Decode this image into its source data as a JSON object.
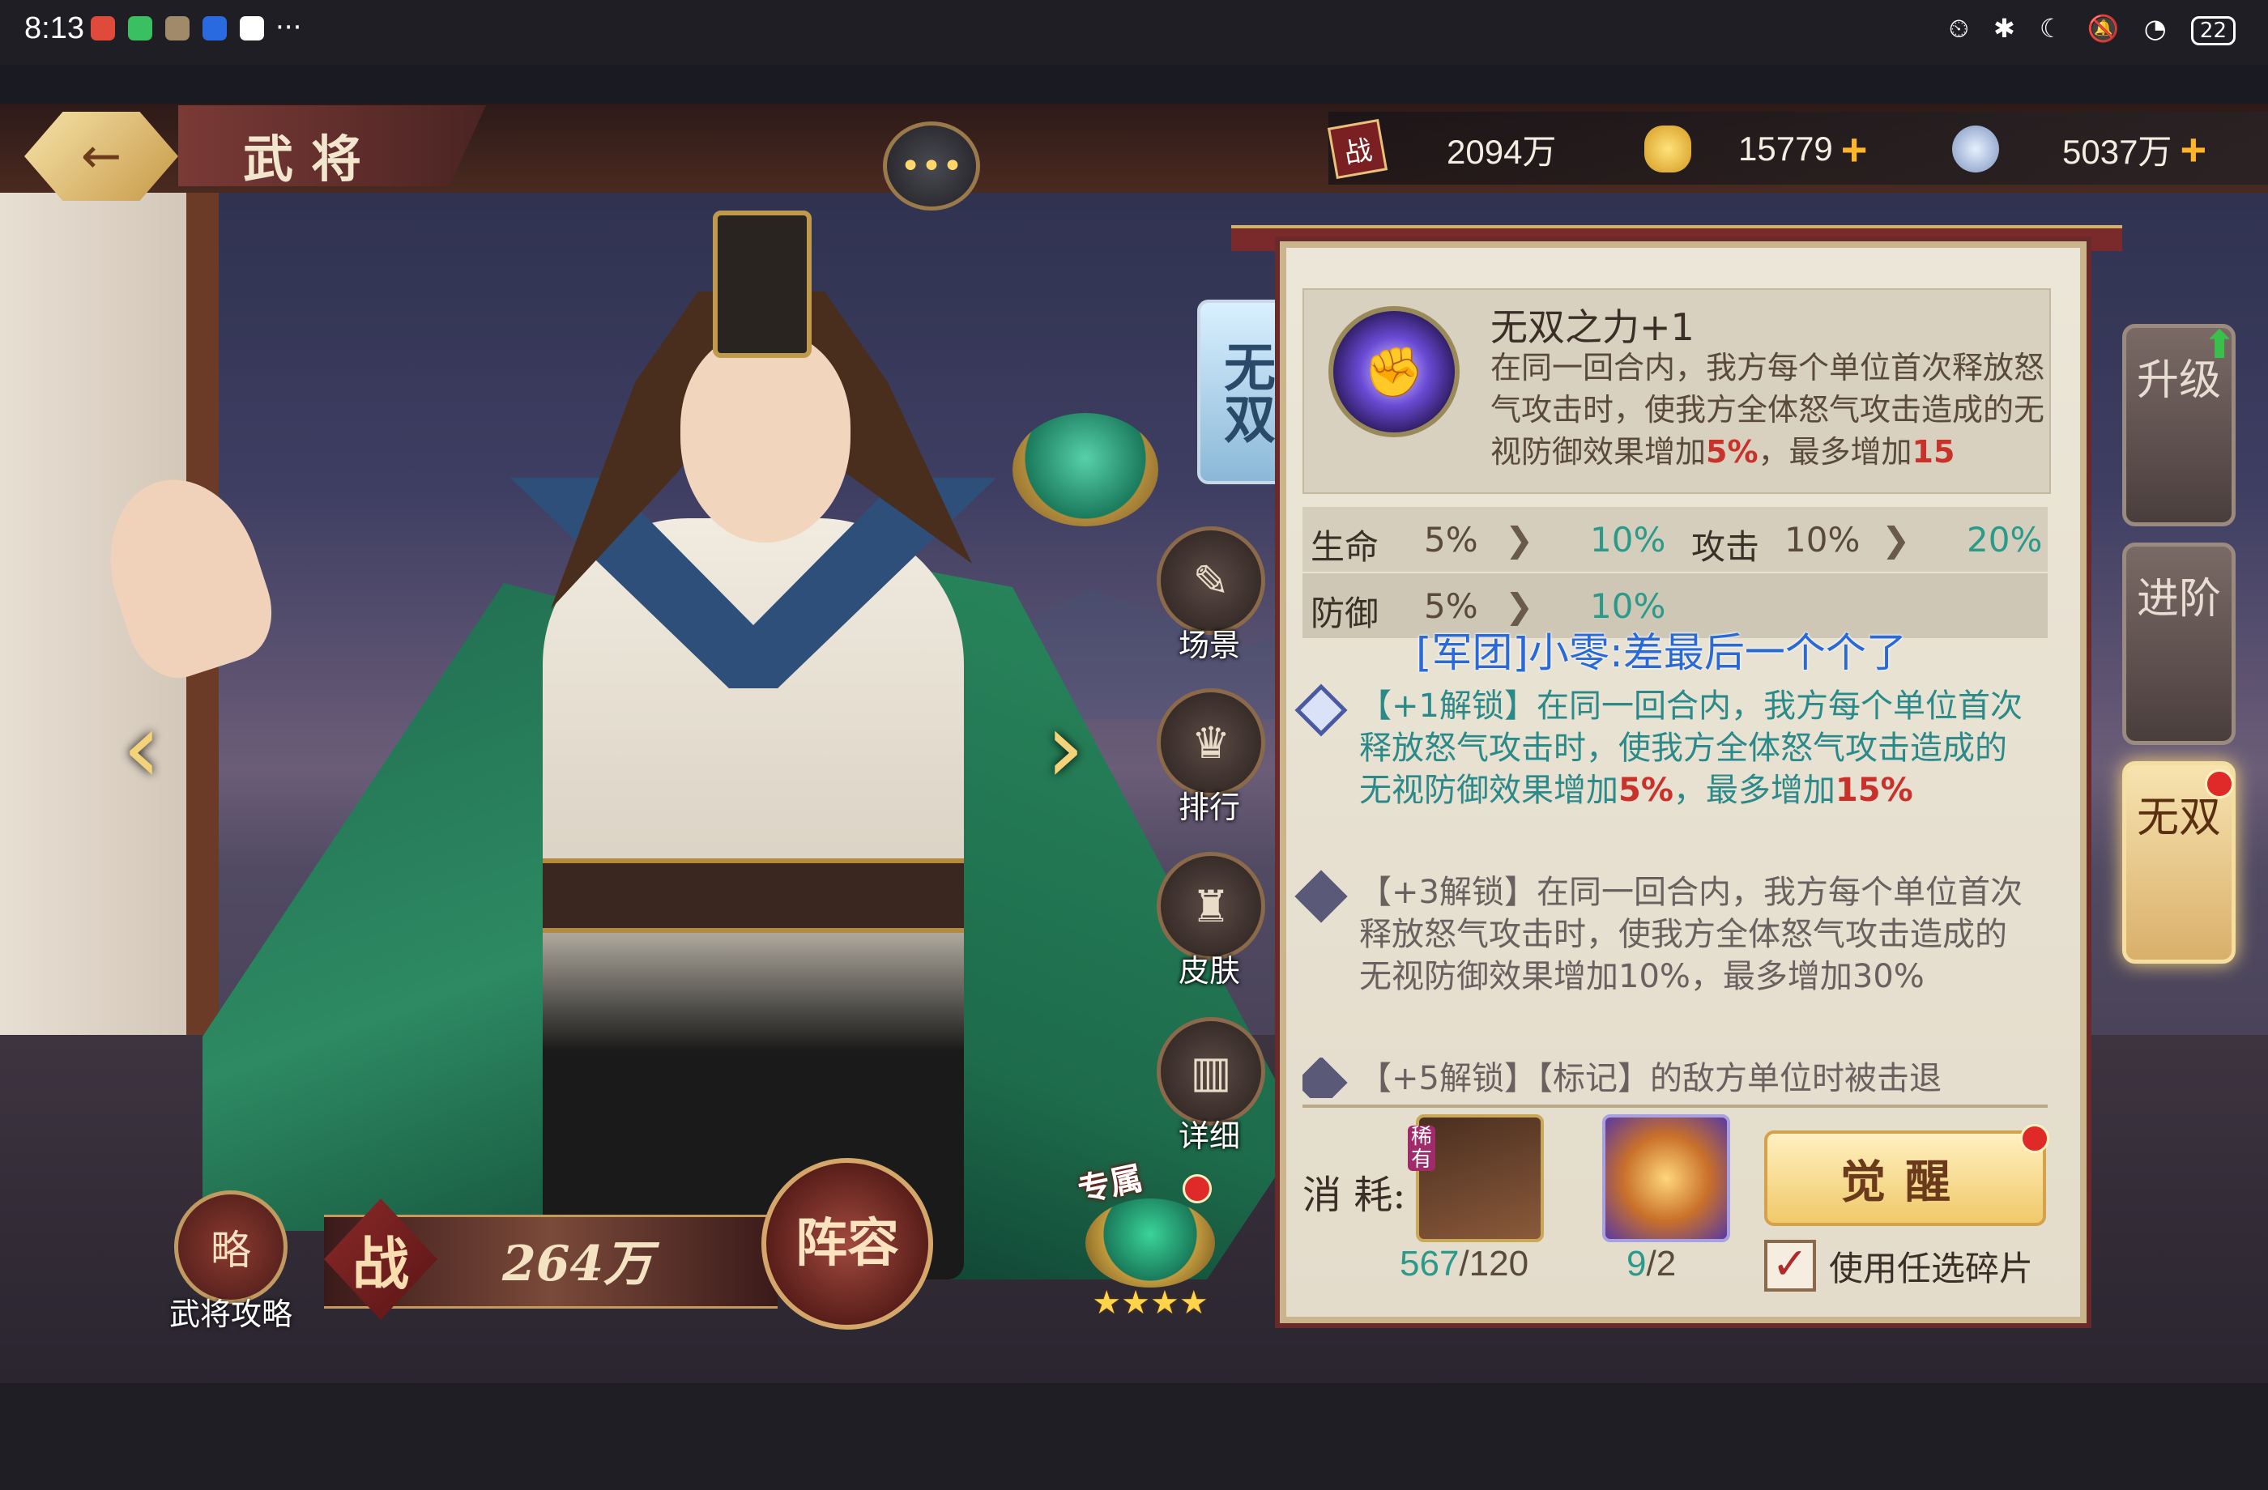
{
  "status_bar": {
    "time": "8:13",
    "more": "···",
    "right_icons": "⏲ ✱ ☾ 🔕 ◔",
    "battery": "22"
  },
  "header": {
    "back_icon": "←",
    "title": "武将",
    "chat_icon": "•••"
  },
  "resources": {
    "power_icon": "战",
    "power_value": "2094万",
    "gold_value": "15779",
    "coin_value": "5037万",
    "plus": "+"
  },
  "hero_side": {
    "wushuang_tag": "无双",
    "scene_label": "场景",
    "rank_label": "排行",
    "skin_label": "皮肤",
    "detail_label": "详细",
    "prev_arrow": "‹",
    "next_arrow": "›"
  },
  "bottom_left": {
    "guide_icon": "略",
    "guide_label": "武将攻略",
    "power_badge": "战",
    "power_value": "264万",
    "lineup_label": "阵容",
    "exclusive_tag": "专属",
    "exclusive_stars": "★★★★"
  },
  "right_tabs": [
    {
      "label": "升级"
    },
    {
      "label": "进阶"
    },
    {
      "label": "无双"
    }
  ],
  "skill": {
    "icon": "✊",
    "name": "无双之力+1",
    "desc_prefix": "在同一回合内，我方每个单位首次释放怒气攻击时，使我方全体怒气攻击造成的无视防御效果增加",
    "desc_pct": "5%",
    "desc_mid": "，最多增加",
    "desc_max": "15"
  },
  "stats": {
    "hp_label": "生命",
    "hp_old": "5%",
    "hp_new": "10%",
    "atk_label": "攻击",
    "atk_old": "10%",
    "atk_new": "20%",
    "def_label": "防御",
    "def_old": "5%",
    "def_new": "10%",
    "arrow": "❯"
  },
  "guild_message": "[军团]小零:差最后一个个了",
  "unlocks": [
    {
      "prefix": "【+1解锁】在同一回合内，我方每个单位首次释放怒气攻击时，使我方全体怒气攻击造成的无视防御效果增加",
      "pct": "5%",
      "mid": "，最多增加",
      "max": "15%"
    },
    {
      "text": "【+3解锁】在同一回合内，我方每个单位首次释放怒气攻击时，使我方全体怒气攻击造成的无视防御效果增加10%，最多增加30%"
    },
    {
      "text": "【+5解锁】【标记】的敌方单位时被击退"
    }
  ],
  "cost": {
    "label": "消 耗:",
    "rare_tag": "稀有",
    "card1_have": "567",
    "card1_need": "/120",
    "card2_have": "9",
    "card2_need": "/2",
    "awaken_label": "觉醒",
    "checkbox_mark": "✓",
    "checkbox_label": "使用任选碎片"
  }
}
